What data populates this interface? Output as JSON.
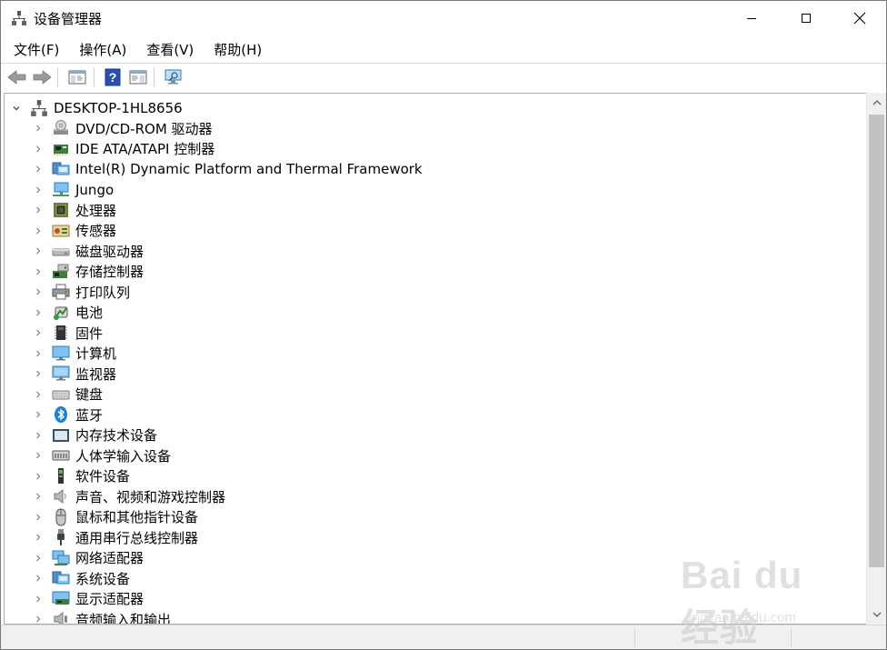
{
  "window": {
    "title": "设备管理器"
  },
  "menu": [
    "文件(F)",
    "操作(A)",
    "查看(V)",
    "帮助(H)"
  ],
  "toolbar": {
    "icons": [
      "back-arrow-icon",
      "forward-arrow-icon",
      "properties-icon",
      "help-icon",
      "action-pane-icon",
      "scan-hardware-icon"
    ]
  },
  "tree": {
    "root": "DESKTOP-1HL8656",
    "items": [
      {
        "label": "DVD/CD-ROM 驱动器",
        "icon": "dvd-drive-icon"
      },
      {
        "label": "IDE ATA/ATAPI 控制器",
        "icon": "ide-controller-icon"
      },
      {
        "label": "Intel(R) Dynamic Platform and Thermal Framework",
        "icon": "system-device-icon"
      },
      {
        "label": "Jungo",
        "icon": "network-computer-icon"
      },
      {
        "label": "处理器",
        "icon": "processor-icon"
      },
      {
        "label": "传感器",
        "icon": "sensor-icon"
      },
      {
        "label": "磁盘驱动器",
        "icon": "disk-drive-icon"
      },
      {
        "label": "存储控制器",
        "icon": "storage-controller-icon"
      },
      {
        "label": "打印队列",
        "icon": "printer-icon"
      },
      {
        "label": "电池",
        "icon": "battery-icon"
      },
      {
        "label": "固件",
        "icon": "firmware-icon"
      },
      {
        "label": "计算机",
        "icon": "computer-icon"
      },
      {
        "label": "监视器",
        "icon": "monitor-icon"
      },
      {
        "label": "键盘",
        "icon": "keyboard-icon"
      },
      {
        "label": "蓝牙",
        "icon": "bluetooth-icon"
      },
      {
        "label": "内存技术设备",
        "icon": "memory-device-icon"
      },
      {
        "label": "人体学输入设备",
        "icon": "hid-icon"
      },
      {
        "label": "软件设备",
        "icon": "software-device-icon"
      },
      {
        "label": "声音、视频和游戏控制器",
        "icon": "speaker-icon"
      },
      {
        "label": "鼠标和其他指针设备",
        "icon": "mouse-icon"
      },
      {
        "label": "通用串行总线控制器",
        "icon": "usb-icon"
      },
      {
        "label": "网络适配器",
        "icon": "network-adapter-icon"
      },
      {
        "label": "系统设备",
        "icon": "system-device-icon"
      },
      {
        "label": "显示适配器",
        "icon": "display-adapter-icon"
      },
      {
        "label": "音频输入和输出",
        "icon": "audio-io-icon"
      }
    ]
  },
  "watermark": {
    "text": "Bai du 经验",
    "sub": "jingyan.baidu.com"
  },
  "colors": {
    "accent_blue": "#1e7fd6",
    "folder_green": "#3a8a3a"
  }
}
